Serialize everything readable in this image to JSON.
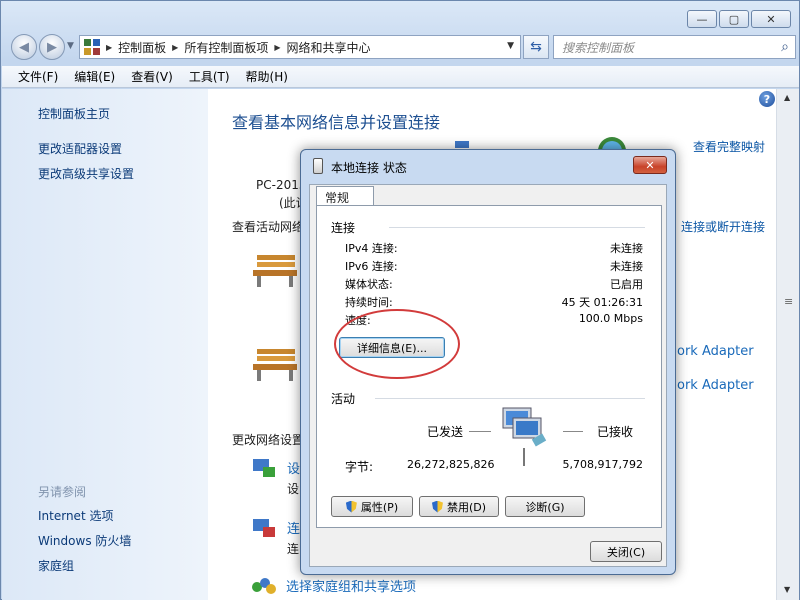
{
  "window": {
    "caption_buttons": {
      "minimize": "—",
      "maximize": "▢",
      "close": "✕"
    }
  },
  "address": {
    "breadcrumbs": [
      "控制面板",
      "所有控制面板项",
      "网络和共享中心"
    ],
    "search_placeholder": "搜索控制面板"
  },
  "menu": [
    "文件(F)",
    "编辑(E)",
    "查看(V)",
    "工具(T)",
    "帮助(H)"
  ],
  "sidebar": {
    "items": [
      "控制面板主页",
      "更改适配器设置",
      "更改高级共享设置"
    ],
    "see_also_header": "另请参阅",
    "see_also": [
      "Internet 选项",
      "Windows 防火墙",
      "家庭组"
    ]
  },
  "main": {
    "title": "查看基本网络信息并设置连接",
    "view_full_map": "查看完整映射",
    "pc_name": "PC-2015",
    "pc_sub": "(此计",
    "active_networks": "查看活动网络",
    "connect_disconnect": "连接或断开连接",
    "adapter1": "ork Adapter",
    "adapter2": "ork Adapter",
    "change_settings": "更改网络设置",
    "set1_link": "设",
    "set1_text": "设",
    "set2_link": "连",
    "set2_text": "连",
    "homegroup_link": "选择家庭组和共享选项"
  },
  "dialog": {
    "title": "本地连接 状态",
    "close_label": "✕",
    "tab": "常规",
    "connection_header": "连接",
    "connection": [
      {
        "key": "IPv4 连接:",
        "value": "未连接"
      },
      {
        "key": "IPv6 连接:",
        "value": "未连接"
      },
      {
        "key": "媒体状态:",
        "value": "已启用"
      },
      {
        "key": "持续时间:",
        "value": "45 天 01:26:31"
      },
      {
        "key": "速度:",
        "value": "100.0 Mbps"
      }
    ],
    "details_button": "详细信息(E)...",
    "activity_header": "活动",
    "sent_label": "已发送",
    "received_label": "已接收",
    "bytes_label": "字节:",
    "bytes_sent": "26,272,825,826",
    "bytes_received": "5,708,917,792",
    "properties_button": "属性(P)",
    "disable_button": "禁用(D)",
    "diagnose_button": "诊断(G)",
    "close_button": "关闭(C)"
  },
  "colors": {
    "link": "#0b56a5",
    "title": "#1d4f91",
    "annotation": "#d23b3b"
  }
}
